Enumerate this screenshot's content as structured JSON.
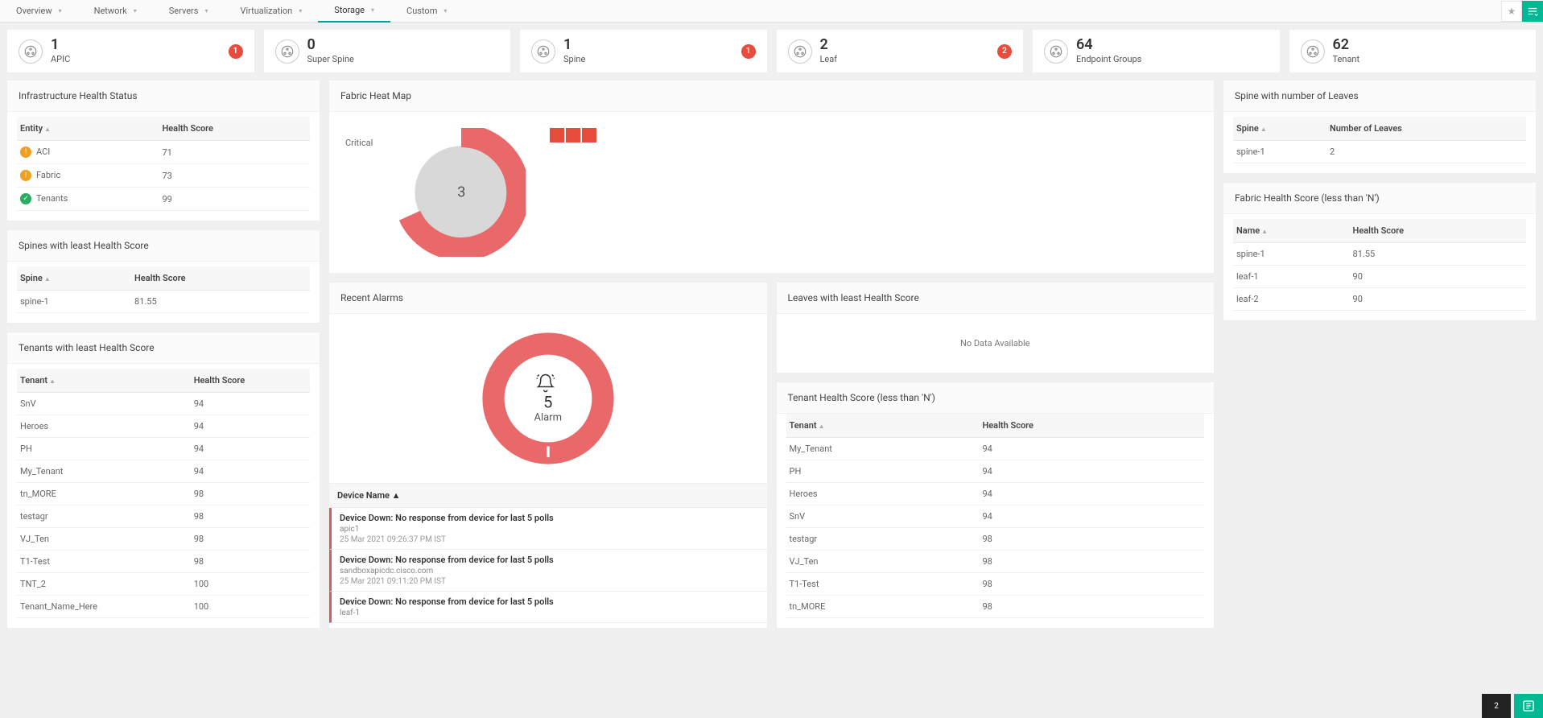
{
  "nav": {
    "tabs": [
      {
        "label": "Overview",
        "active": false
      },
      {
        "label": "Network",
        "active": false
      },
      {
        "label": "Servers",
        "active": false
      },
      {
        "label": "Virtualization",
        "active": false
      },
      {
        "label": "Storage",
        "active": true
      },
      {
        "label": "Custom",
        "active": false
      }
    ]
  },
  "summary": [
    {
      "value": "1",
      "label": "APIC",
      "badge": "1"
    },
    {
      "value": "0",
      "label": "Super Spine",
      "badge": null
    },
    {
      "value": "1",
      "label": "Spine",
      "badge": "1"
    },
    {
      "value": "2",
      "label": "Leaf",
      "badge": "2"
    },
    {
      "value": "64",
      "label": "Endpoint Groups",
      "badge": null
    },
    {
      "value": "62",
      "label": "Tenant",
      "badge": null
    }
  ],
  "infra_health": {
    "title": "Infrastructure Health Status",
    "cols": [
      "Entity",
      "Health Score"
    ],
    "rows": [
      {
        "status": "warn",
        "name": "ACI",
        "score": "71"
      },
      {
        "status": "warn",
        "name": "Fabric",
        "score": "73"
      },
      {
        "status": "ok",
        "name": "Tenants",
        "score": "99"
      }
    ]
  },
  "spines_least": {
    "title": "Spines with least Health Score",
    "cols": [
      "Spine",
      "Health Score"
    ],
    "rows": [
      {
        "name": "spine-1",
        "score": "81.55"
      }
    ]
  },
  "tenants_least": {
    "title": "Tenants with least Health Score",
    "cols": [
      "Tenant",
      "Health Score"
    ],
    "rows": [
      {
        "name": "SnV",
        "score": "94"
      },
      {
        "name": "Heroes",
        "score": "94"
      },
      {
        "name": "PH",
        "score": "94"
      },
      {
        "name": "My_Tenant",
        "score": "94"
      },
      {
        "name": "tn_MORE",
        "score": "98"
      },
      {
        "name": "testagr",
        "score": "98"
      },
      {
        "name": "VJ_Ten",
        "score": "98"
      },
      {
        "name": "T1-Test",
        "score": "98"
      },
      {
        "name": "TNT_2",
        "score": "100"
      },
      {
        "name": "Tenant_Name_Here",
        "score": "100"
      }
    ]
  },
  "heatmap": {
    "title": "Fabric Heat Map",
    "critical_label": "Critical",
    "count": "3"
  },
  "recent_alarms": {
    "title": "Recent Alarms",
    "count": "5",
    "label": "Alarm",
    "device_col": "Device Name",
    "items": [
      {
        "msg": "Device Down: No response from device for last 5 polls",
        "dev": "apic1",
        "ts": "25 Mar 2021 09:26:37 PM IST"
      },
      {
        "msg": "Device Down: No response from device for last 5 polls",
        "dev": "sandboxapicdc.cisco.com",
        "ts": "25 Mar 2021 09:11:20 PM IST"
      },
      {
        "msg": "Device Down: No response from device for last 5 polls",
        "dev": "leaf-1",
        "ts": ""
      }
    ]
  },
  "leaves_least": {
    "title": "Leaves with least Health Score",
    "nodata": "No Data Available"
  },
  "tenant_health_n": {
    "title": "Tenant Health Score (less than 'N')",
    "cols": [
      "Tenant",
      "Health Score"
    ],
    "rows": [
      {
        "name": "My_Tenant",
        "score": "94"
      },
      {
        "name": "PH",
        "score": "94"
      },
      {
        "name": "Heroes",
        "score": "94"
      },
      {
        "name": "SnV",
        "score": "94"
      },
      {
        "name": "testagr",
        "score": "98"
      },
      {
        "name": "VJ_Ten",
        "score": "98"
      },
      {
        "name": "T1-Test",
        "score": "98"
      },
      {
        "name": "tn_MORE",
        "score": "98"
      }
    ]
  },
  "spine_leaves": {
    "title": "Spine with number of Leaves",
    "cols": [
      "Spine",
      "Number of Leaves"
    ],
    "rows": [
      {
        "name": "spine-1",
        "count": "2"
      }
    ]
  },
  "fabric_health_n": {
    "title": "Fabric Health Score (less than 'N')",
    "cols": [
      "Name",
      "Health Score"
    ],
    "rows": [
      {
        "name": "spine-1",
        "score": "81.55"
      },
      {
        "name": "leaf-1",
        "score": "90"
      },
      {
        "name": "leaf-2",
        "score": "90"
      }
    ]
  },
  "bottom_badge": "2",
  "chart_data": [
    {
      "type": "pie",
      "title": "Fabric Heat Map",
      "categories": [
        "Critical"
      ],
      "values": [
        3
      ],
      "colors": [
        "#e74c3c"
      ]
    },
    {
      "type": "pie",
      "title": "Recent Alarms",
      "categories": [
        "Alarm"
      ],
      "values": [
        5
      ],
      "colors": [
        "#e9696a"
      ]
    }
  ]
}
